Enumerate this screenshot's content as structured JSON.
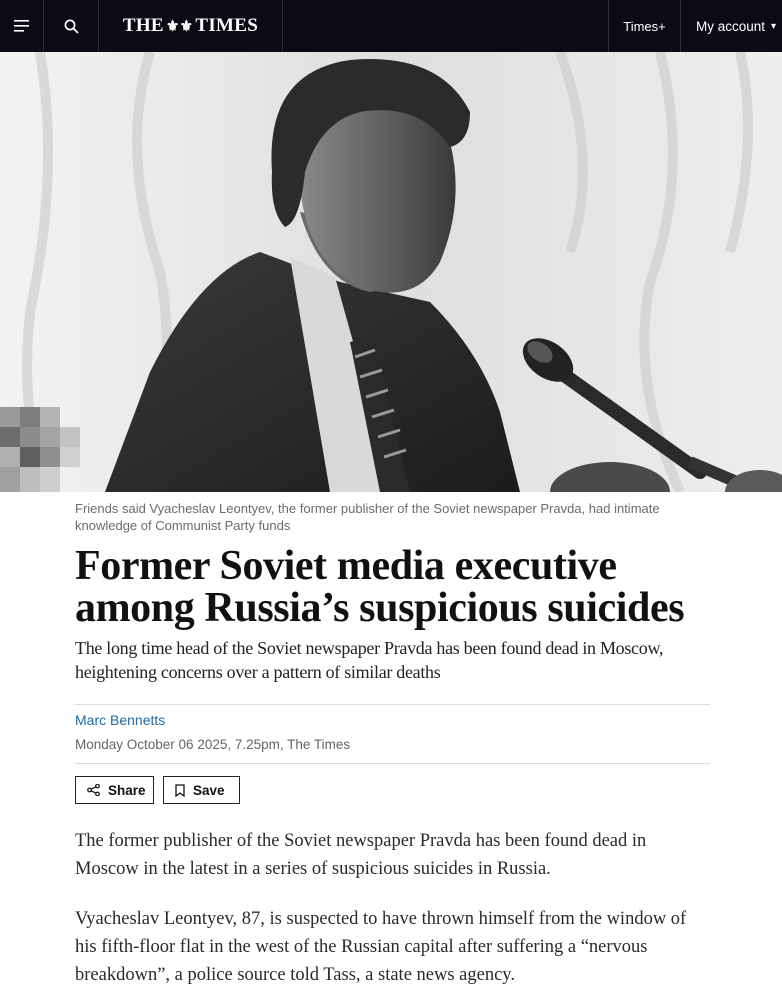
{
  "nav": {
    "logo_left": "THE",
    "logo_crest": "⚜⚜",
    "logo_right": "TIMES",
    "times_plus": "Times+",
    "my_account": "My account"
  },
  "hero": {
    "caption": "Friends said Vyacheslav Leontyev, the former publisher of the Soviet newspaper Pravda, had intimate knowledge of Communist Party funds"
  },
  "article": {
    "headline": "Former Soviet media executive among Russia’s suspicious suicides",
    "standfirst": "The long time head of the Soviet newspaper Pravda has been found dead in Moscow, heightening concerns over a pattern of similar deaths",
    "author": "Marc Bennetts",
    "dateline": "Monday October 06 2025, 7.25pm, The Times",
    "share_label": "Share",
    "save_label": "Save",
    "paragraphs": [
      "The former publisher of the Soviet newspaper Pravda has been found dead in Moscow in the latest in a series of suspicious suicides in Russia.",
      "Vyacheslav Leontyev, 87, is suspected to have thrown himself from the window of his fifth-floor flat in the west of the Russian capital after suffering a “nervous breakdown”, a police source told Tass, a state news agency."
    ]
  },
  "colors": {
    "nav_bg": "#0b0b16",
    "author_link": "#1f6aa3",
    "caption_text": "#6b6b6b"
  },
  "icons": [
    "hamburger-menu-icon",
    "search-icon",
    "share-icon",
    "bookmark-icon",
    "chevron-down-icon"
  ]
}
